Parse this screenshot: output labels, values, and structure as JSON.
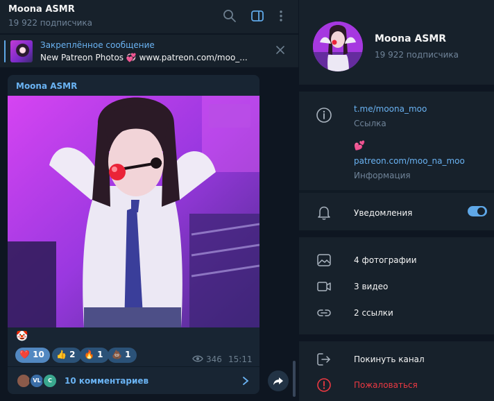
{
  "chat": {
    "title": "Moona ASMR",
    "subtitle": "19 922 подписчика",
    "header_icons": [
      "search-icon",
      "sidebar-toggle-icon",
      "more-vertical-icon"
    ]
  },
  "pinned": {
    "title": "Закреплённое сообщение",
    "text": "New Patreon Photos 💞 www.patreon.com/moo_..."
  },
  "message": {
    "author": "Moona ASMR",
    "emoji": "🤡",
    "reactions": [
      {
        "emoji": "❤️",
        "count": "10"
      },
      {
        "emoji": "👍",
        "count": "2"
      },
      {
        "emoji": "🔥",
        "count": "1"
      },
      {
        "emoji": "💩",
        "count": "1"
      }
    ],
    "views": "346",
    "time": "15:11",
    "comments_label": "10 комментариев",
    "comment_avatars": [
      "VL",
      "C"
    ]
  },
  "profile": {
    "name": "Moona ASMR",
    "subtitle": "19 922 подписчика",
    "link": "t.me/moona_moo",
    "link_label": "Ссылка",
    "info_emoji": "💕",
    "info_link": "patreon.com/moo_na_moo",
    "info_label": "Информация",
    "notifications_label": "Уведомления",
    "notifications_on": true,
    "media": {
      "photos": "4 фотографии",
      "videos": "3 видео",
      "links": "2 ссылки"
    },
    "leave_label": "Покинуть канал",
    "report_label": "Пожаловаться"
  },
  "colors": {
    "accent": "#5fa8e8",
    "link": "#6ab3f3",
    "danger": "#ec3942",
    "panel": "#17212b",
    "background": "#0e1621",
    "bubble": "#182533"
  }
}
